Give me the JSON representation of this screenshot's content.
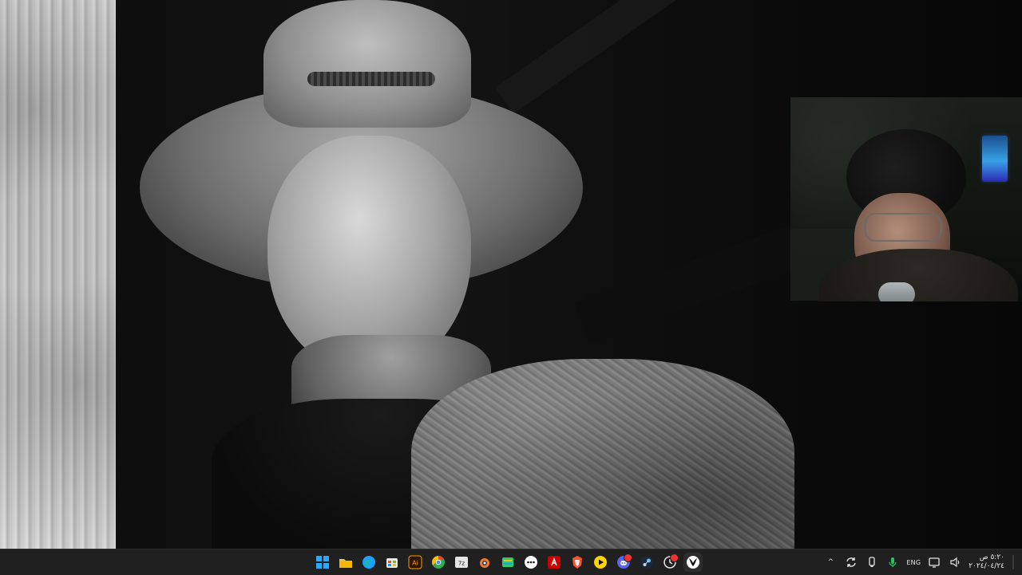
{
  "taskbar": {
    "apps": [
      {
        "name": "start",
        "icon": "windows-start-icon",
        "active": false
      },
      {
        "name": "file-explorer",
        "icon": "folder-icon",
        "active": false
      },
      {
        "name": "edge",
        "icon": "edge-icon",
        "active": false
      },
      {
        "name": "microsoft-store",
        "icon": "store-icon",
        "active": false
      },
      {
        "name": "adobe-illustrator",
        "icon": "illustrator-icon",
        "label": "Ai",
        "active": false
      },
      {
        "name": "chrome",
        "icon": "chrome-icon",
        "active": false
      },
      {
        "name": "7zip",
        "icon": "7zip-icon",
        "label": "7z",
        "active": false
      },
      {
        "name": "blender",
        "icon": "blender-icon",
        "active": false
      },
      {
        "name": "app-green",
        "icon": "layers-icon",
        "active": false
      },
      {
        "name": "app-dots",
        "icon": "dots-icon",
        "active": false
      },
      {
        "name": "acrobat",
        "icon": "acrobat-icon",
        "active": false
      },
      {
        "name": "brave",
        "icon": "brave-icon",
        "active": false
      },
      {
        "name": "media-player",
        "icon": "play-icon",
        "active": false
      },
      {
        "name": "discord",
        "icon": "discord-icon",
        "active": false,
        "badge": true
      },
      {
        "name": "steam",
        "icon": "steam-icon",
        "active": false
      },
      {
        "name": "app-notify",
        "icon": "clock-badge-icon",
        "active": false,
        "badge": true
      },
      {
        "name": "xbox",
        "icon": "xbox-icon",
        "active": true
      }
    ],
    "tray": {
      "chevron_label": "^",
      "lang": "ENG",
      "time": "٥:٢٠ ص",
      "date": "٢٠٢٤/٠٤/٢٤"
    }
  }
}
